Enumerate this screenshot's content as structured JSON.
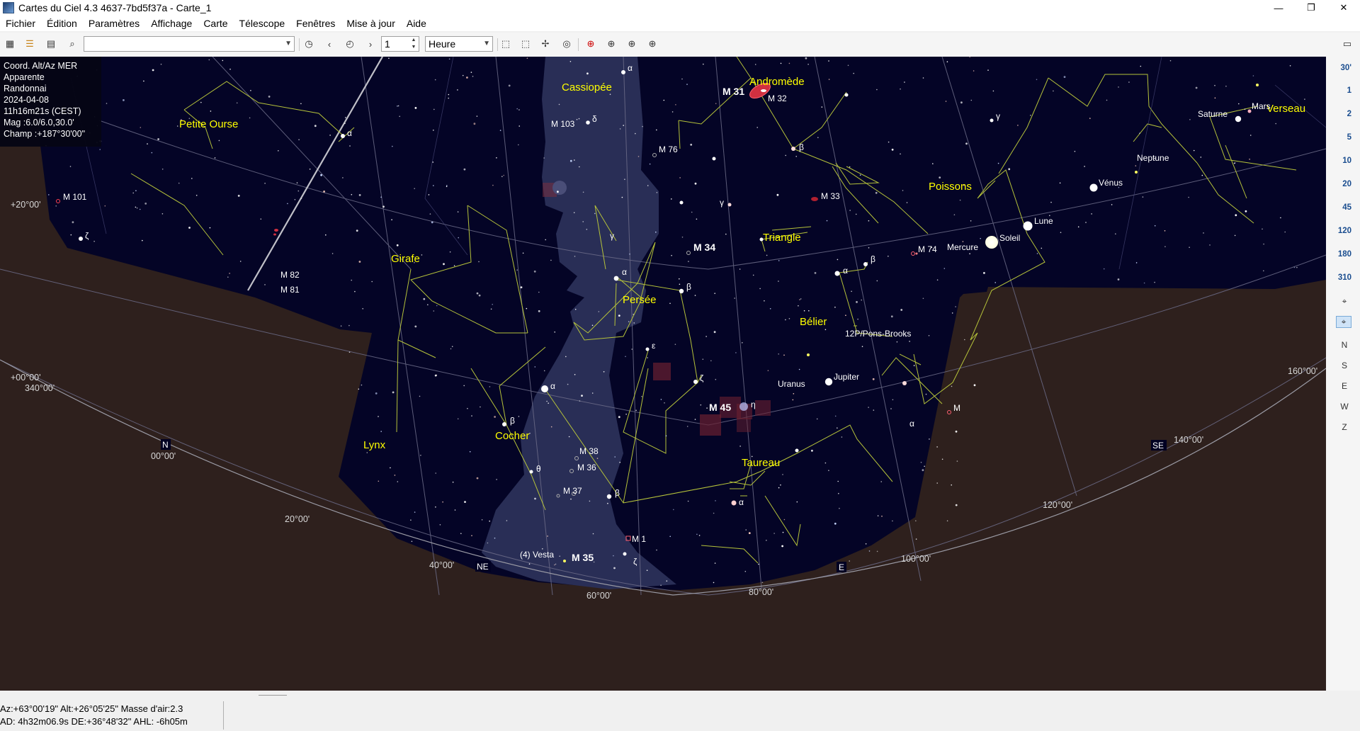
{
  "window": {
    "title": "Cartes du Ciel 4.3 4637-7bd5f37a - Carte_1",
    "controls": [
      "—",
      "❐",
      "✕"
    ]
  },
  "menu": [
    "Fichier",
    "Édition",
    "Paramètres",
    "Affichage",
    "Carte",
    "Télescope",
    "Fenêtres",
    "Mise à jour",
    "Aide"
  ],
  "toolbar": {
    "search_value": "",
    "step_value": "1",
    "unit_value": "Heure"
  },
  "info": {
    "line1": "Coord. Alt/Az MER",
    "line2": "Apparente",
    "line3": "Randonnai",
    "line4": "2024-04-08",
    "line5": "11h16m21s (CEST)",
    "line6": "Mag :6.0/6.0,30.0'",
    "line7": "Champ :+187°30'00\""
  },
  "fov_buttons": [
    "30'",
    "1",
    "2",
    "5",
    "10",
    "20",
    "45",
    "120",
    "180",
    "310"
  ],
  "orientation_buttons": [
    "N",
    "S",
    "E",
    "W",
    "Z"
  ],
  "constellations": [
    "Cassiopée",
    "Andromède",
    "Petite Ourse",
    "Poissons",
    "Verseau",
    "Girafe",
    "Triangle",
    "Persée",
    "Bélier",
    "Lynx",
    "Cocher",
    "Taureau"
  ],
  "objects": {
    "m31": "M 31",
    "m32": "M 32",
    "m103": "M 103",
    "m76": "M 76",
    "m33": "M 33",
    "m101": "M 101",
    "m34": "M 34",
    "m74": "M 74",
    "m82": "M 82",
    "m81": "M 81",
    "m45": "M 45",
    "m38": "M 38",
    "m36": "M 36",
    "m37": "M 37",
    "m1": "M 1",
    "m35": "M 35",
    "vesta": "(4) Vesta",
    "comet": "12P/Pons-Brooks"
  },
  "planets": {
    "saturne": "Saturne",
    "mars": "Mars",
    "neptune": "Neptune",
    "venus": "Vénus",
    "lune": "Lune",
    "soleil": "Soleil",
    "mercure": "Mercure",
    "uranus": "Uranus",
    "jupiter": "Jupiter"
  },
  "greek": {
    "alpha": "α",
    "beta": "β",
    "gamma": "γ",
    "delta": "δ",
    "epsilon": "ε",
    "zeta": "ζ",
    "eta": "η",
    "theta": "θ",
    "mu": "M"
  },
  "grid_labels": {
    "dec20": "+20°00'",
    "dec0": "+00°00'",
    "ra340": "340°00'",
    "az0": "00°00'",
    "az20": "20°00'",
    "az40": "40°00'",
    "az60": "60°00'",
    "az80": "80°00'",
    "az100": "100°00'",
    "az120": "120°00'",
    "az140": "140°00'",
    "az160": "160°00'"
  },
  "cardinals": {
    "n": "N",
    "ne": "NE",
    "e": "E",
    "se": "SE"
  },
  "status": {
    "line1": "Az:+63°00'19\" Alt:+26°05'25\" Masse d'air:2.3",
    "line2": "AD:  4h32m06.9s DE:+36°48'32\" AHL: -6h05m"
  }
}
